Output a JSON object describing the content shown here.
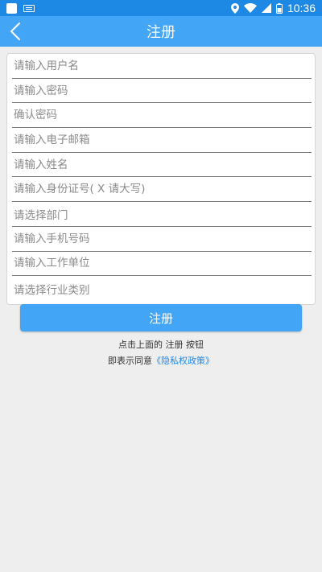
{
  "status_bar": {
    "time": "10:36"
  },
  "app_bar": {
    "title": "注册"
  },
  "form": {
    "fields": [
      {
        "placeholder": "请输入用户名",
        "type": "input"
      },
      {
        "placeholder": "请输入密码",
        "type": "input"
      },
      {
        "placeholder": "确认密码",
        "type": "input"
      },
      {
        "placeholder": "请输入电子邮箱",
        "type": "input"
      },
      {
        "placeholder": "请输入姓名",
        "type": "input"
      },
      {
        "placeholder": "请输入身份证号( X 请大写)",
        "type": "input"
      },
      {
        "placeholder": "请选择部门",
        "type": "select"
      },
      {
        "placeholder": "请输入手机号码",
        "type": "input"
      },
      {
        "placeholder": "请输入工作单位",
        "type": "input"
      },
      {
        "placeholder": "请选择行业类别",
        "type": "select"
      }
    ]
  },
  "register_button": {
    "label": "注册"
  },
  "notes": {
    "line1": "点击上面的 注册 按钮",
    "line2_prefix": "即表示同意",
    "privacy_link": "《隐私权政策》"
  },
  "colors": {
    "status_bar": "#1e88e5",
    "app_bar": "#42a5f5",
    "button": "#42a5f5",
    "link": "#1e88e5"
  }
}
